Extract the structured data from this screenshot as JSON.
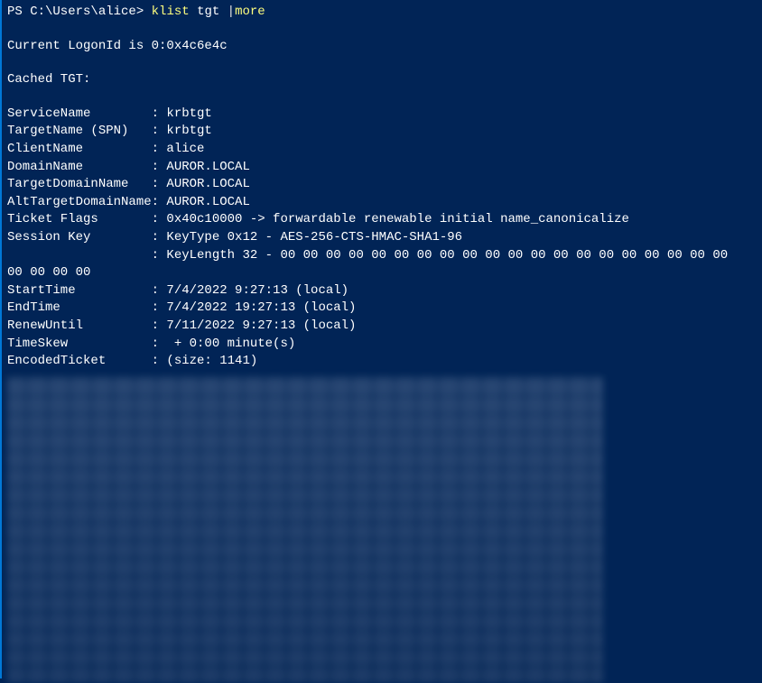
{
  "prompt": {
    "path": "PS C:\\Users\\alice> ",
    "cmd1": "klist ",
    "arg": "tgt ",
    "pipe": "|",
    "cmd2": "more"
  },
  "logon": "Current LogonId is 0:0x4c6e4c",
  "cached": "Cached TGT:",
  "fields": {
    "ServiceName": "ServiceName        : krbtgt",
    "TargetName": "TargetName (SPN)   : krbtgt",
    "ClientName": "ClientName         : alice",
    "DomainName": "DomainName         : AUROR.LOCAL",
    "TargetDomainName": "TargetDomainName   : AUROR.LOCAL",
    "AltTargetDomainName": "AltTargetDomainName: AUROR.LOCAL",
    "TicketFlags": "Ticket Flags       : 0x40c10000 -> forwardable renewable initial name_canonicalize",
    "SessionKey1": "Session Key        : KeyType 0x12 - AES-256-CTS-HMAC-SHA1-96",
    "SessionKey2": "                   : KeyLength 32 - 00 00 00 00 00 00 00 00 00 00 00 00 00 00 00 00 00 00 00 00",
    "SessionKey3": "00 00 00 00",
    "StartTime": "StartTime          : 7/4/2022 9:27:13 (local)",
    "EndTime": "EndTime            : 7/4/2022 19:27:13 (local)",
    "RenewUntil": "RenewUntil         : 7/11/2022 9:27:13 (local)",
    "TimeSkew": "TimeSkew           :  + 0:00 minute(s)",
    "EncodedTicket": "EncodedTicket      : (size: 1141)"
  }
}
